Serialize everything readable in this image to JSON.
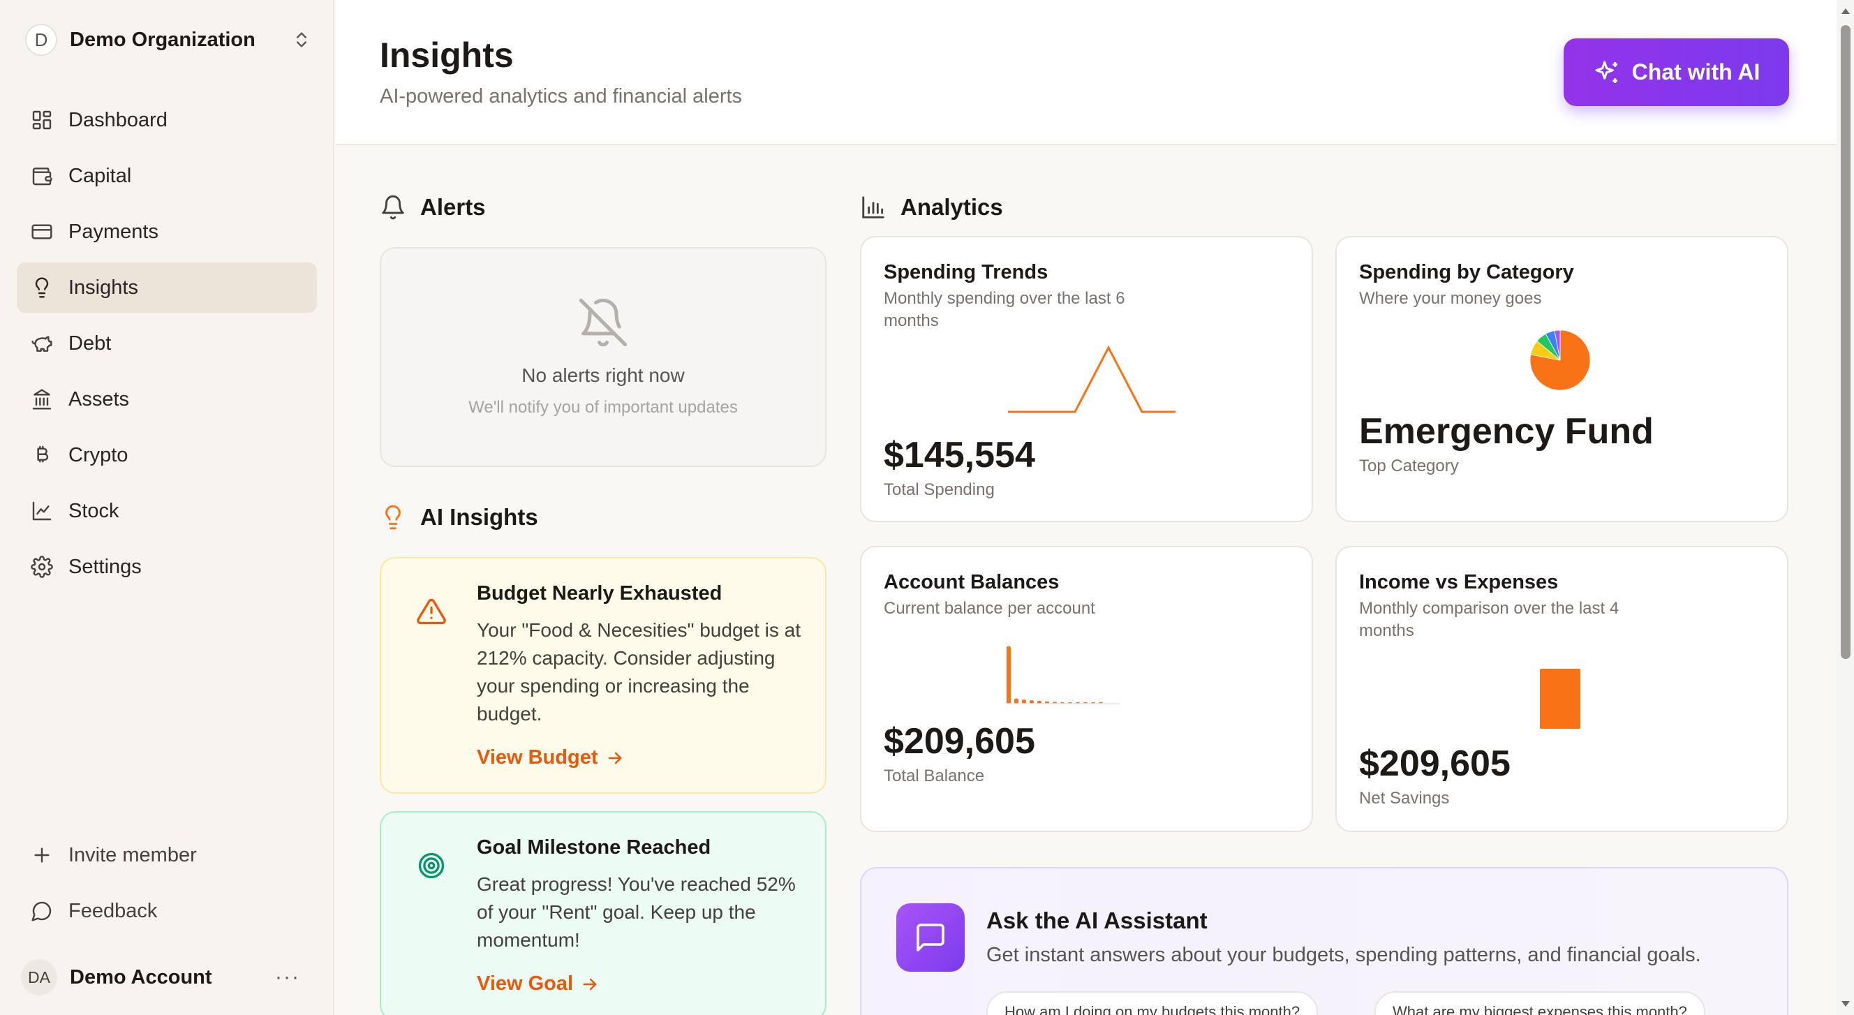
{
  "org": {
    "initial": "D",
    "name": "Demo Organization"
  },
  "nav": [
    {
      "label": "Dashboard",
      "icon": "layout-grid-icon"
    },
    {
      "label": "Capital",
      "icon": "wallet-icon"
    },
    {
      "label": "Payments",
      "icon": "credit-card-icon"
    },
    {
      "label": "Insights",
      "icon": "lightbulb-icon",
      "active": true
    },
    {
      "label": "Debt",
      "icon": "piggy-bank-icon"
    },
    {
      "label": "Assets",
      "icon": "landmark-icon"
    },
    {
      "label": "Crypto",
      "icon": "bitcoin-icon"
    },
    {
      "label": "Stock",
      "icon": "line-chart-icon"
    },
    {
      "label": "Settings",
      "icon": "gear-icon"
    }
  ],
  "sidebar_bottom": {
    "invite": "Invite member",
    "feedback": "Feedback"
  },
  "account": {
    "initials": "DA",
    "name": "Demo Account",
    "more": "···"
  },
  "header": {
    "title": "Insights",
    "subtitle": "AI-powered analytics and financial alerts",
    "chat_button": "Chat with AI"
  },
  "alerts": {
    "title": "Alerts",
    "empty_title": "No alerts right now",
    "empty_sub": "We'll notify you of important updates"
  },
  "ai_insights": {
    "title": "AI Insights",
    "cards": [
      {
        "title": "Budget Nearly Exhausted",
        "body": "Your \"Food & Necesities\" budget is at 212% capacity. Consider adjusting your spending or increasing the budget.",
        "link": "View Budget"
      },
      {
        "title": "Goal Milestone Reached",
        "body": "Great progress! You've reached 52% of your \"Rent\" goal. Keep up the momentum!",
        "link": "View Goal"
      }
    ]
  },
  "analytics": {
    "title": "Analytics",
    "cards": {
      "spending_trends": {
        "title": "Spending Trends",
        "subtitle": "Monthly spending over the last 6 months",
        "value": "$145,554",
        "label": "Total Spending"
      },
      "spending_category": {
        "title": "Spending by Category",
        "subtitle": "Where your money goes",
        "value": "Emergency Fund",
        "label": "Top Category"
      },
      "account_balances": {
        "title": "Account Balances",
        "subtitle": "Current balance per account",
        "value": "$209,605",
        "label": "Total Balance"
      },
      "income_expenses": {
        "title": "Income vs Expenses",
        "subtitle": "Monthly comparison over the last 4 months",
        "value": "$209,605",
        "label": "Net Savings"
      }
    }
  },
  "assistant": {
    "title": "Ask the AI Assistant",
    "subtitle": "Get instant answers about your budgets, spending patterns, and financial goals.",
    "chips": [
      "How am I doing on my budgets this month?",
      "What are my biggest expenses this month?"
    ]
  },
  "colors": {
    "accent_orange": "#f97316",
    "accent_purple": "#7c3aed",
    "pie": [
      "#f97316",
      "#facc15",
      "#22c55e",
      "#3b82f6",
      "#a855f7"
    ]
  },
  "chart_data": [
    {
      "type": "line",
      "x": [
        1,
        2,
        3,
        4,
        5,
        6
      ],
      "values": [
        0,
        0,
        0,
        145554,
        0,
        0
      ],
      "ylim": [
        0,
        145554
      ]
    },
    {
      "type": "pie",
      "categories": [
        "Emergency Fund",
        "Category 2",
        "Category 3",
        "Category 4",
        "Category 5"
      ],
      "values": [
        78,
        8,
        6,
        5,
        3
      ]
    },
    {
      "type": "bar",
      "values": [
        100,
        9,
        7,
        6,
        5,
        4,
        3,
        2,
        2,
        1,
        1,
        1,
        1
      ]
    },
    {
      "type": "bar",
      "values": [
        209605
      ]
    }
  ]
}
